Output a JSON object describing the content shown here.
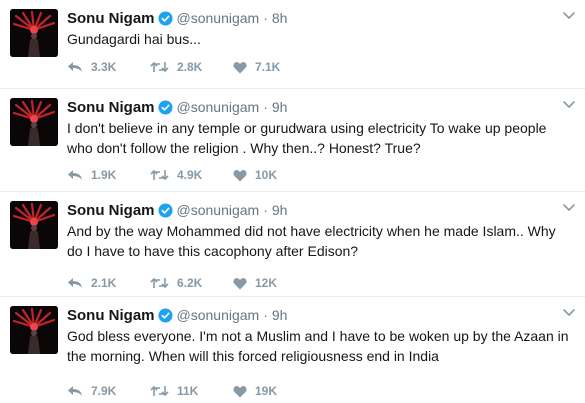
{
  "tweets": [
    {
      "name": "Sonu Nigam",
      "handle": "@sonunigam",
      "separator": "·",
      "time": "8h",
      "text": "Gundagardi hai bus...",
      "replies": "3.3K",
      "retweets": "2.8K",
      "likes": "7.1K"
    },
    {
      "name": "Sonu Nigam",
      "handle": "@sonunigam",
      "separator": "·",
      "time": "9h",
      "text": "I don't believe in any temple or gurudwara using electricity To wake up people who don't follow the religion . Why then..? Honest? True?",
      "replies": "1.9K",
      "retweets": "4.9K",
      "likes": "10K"
    },
    {
      "name": "Sonu Nigam",
      "handle": "@sonunigam",
      "separator": "·",
      "time": "9h",
      "text": "And by the way Mohammed did not have electricity when he made Islam.. Why do I have to have this cacophony after Edison?",
      "replies": "2.1K",
      "retweets": "6.2K",
      "likes": "12K"
    },
    {
      "name": "Sonu Nigam",
      "handle": "@sonunigam",
      "separator": "·",
      "time": "9h",
      "text": "God bless everyone. I'm not a Muslim and I have to be woken up by the Azaan in the morning. When will this forced religiousness end in India",
      "replies": "7.9K",
      "retweets": "11K",
      "likes": "19K"
    }
  ],
  "icons": {
    "verified": "verified-badge-icon",
    "caret": "chevron-down-icon",
    "reply": "reply-icon",
    "retweet": "retweet-icon",
    "like": "heart-icon"
  },
  "colors": {
    "verified": "#1da1f2",
    "action_gray": "#8899a6",
    "meta_gray": "#657786",
    "text": "#14171a",
    "divider": "#e6ecf0"
  }
}
